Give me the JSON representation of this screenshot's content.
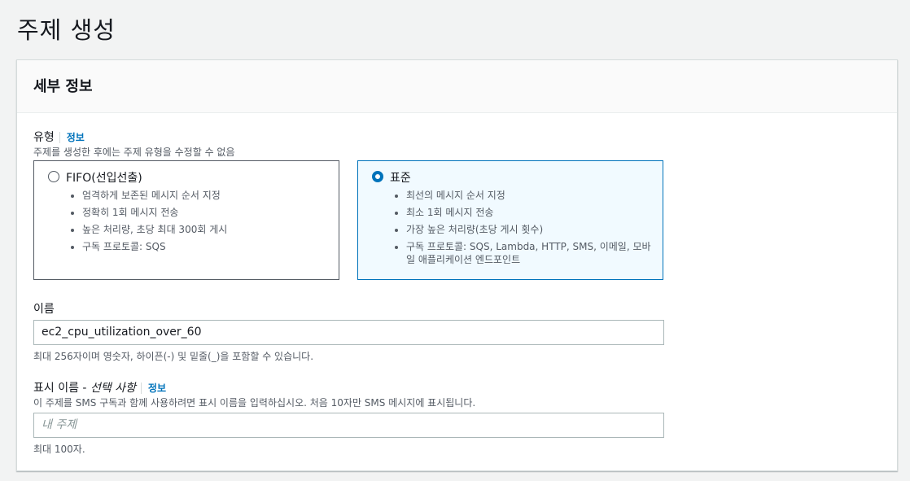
{
  "page": {
    "title": "주제 생성"
  },
  "panel": {
    "title": "세부 정보"
  },
  "type_field": {
    "label": "유형",
    "info": "정보",
    "description": "주제를 생성한 후에는 주제 유형을 수정할 수 없음",
    "options": [
      {
        "title": "FIFO(선입선출)",
        "selected": false,
        "bullets": [
          "엄격하게 보존된 메시지 순서 지정",
          "정확히 1회 메시지 전송",
          "높은 처리량, 초당 최대 300회 게시",
          "구독 프로토콜: SQS"
        ]
      },
      {
        "title": "표준",
        "selected": true,
        "bullets": [
          "최선의 메시지 순서 지정",
          "최소 1회 메시지 전송",
          "가장 높은 처리량(초당 게시 횟수)",
          "구독 프로토콜: SQS, Lambda, HTTP, SMS, 이메일, 모바일 애플리케이션 엔드포인트"
        ]
      }
    ]
  },
  "name_field": {
    "label": "이름",
    "value": "ec2_cpu_utilization_over_60",
    "hint": "최대 256자이며 영숫자, 하이픈(-) 및 밑줄(_)을 포함할 수 있습니다."
  },
  "display_name_field": {
    "label": "표시 이름 - ",
    "label_optional": "선택 사항",
    "info": "정보",
    "description": "이 주제를 SMS 구독과 함께 사용하려면 표시 이름을 입력하십시오. 처음 10자만 SMS 메시지에 표시됩니다.",
    "placeholder": "내 주제",
    "hint": "최대 100자."
  },
  "colors": {
    "accent": "#0073bb",
    "selected_bg": "#f1faff"
  }
}
